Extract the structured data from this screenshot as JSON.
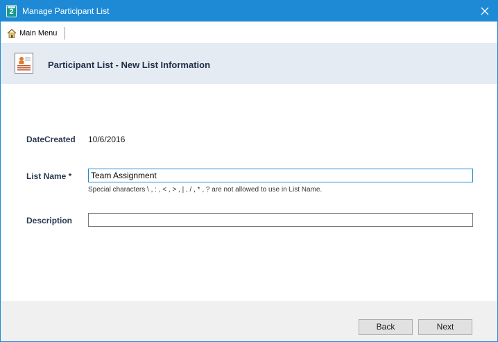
{
  "window": {
    "title": "Manage Participant List",
    "app_icon_number": "2"
  },
  "menubar": {
    "main_menu_label": "Main Menu"
  },
  "header": {
    "title": "Participant List - New List Information"
  },
  "form": {
    "date_created_label": "DateCreated",
    "date_created_value": "10/6/2016",
    "list_name_label": "List Name *",
    "list_name_value": "Team Assignment",
    "list_name_hint": "Special characters \\ , : , < , > , | ,  / , * , ?  are not allowed to use in List Name.",
    "description_label": "Description",
    "description_value": ""
  },
  "footer": {
    "back_label": "Back",
    "next_label": "Next"
  },
  "colors": {
    "titlebar": "#1e8ad6",
    "header_band": "#e5ebf2",
    "footer": "#f0f0f0",
    "label_text": "#2b3a52"
  }
}
